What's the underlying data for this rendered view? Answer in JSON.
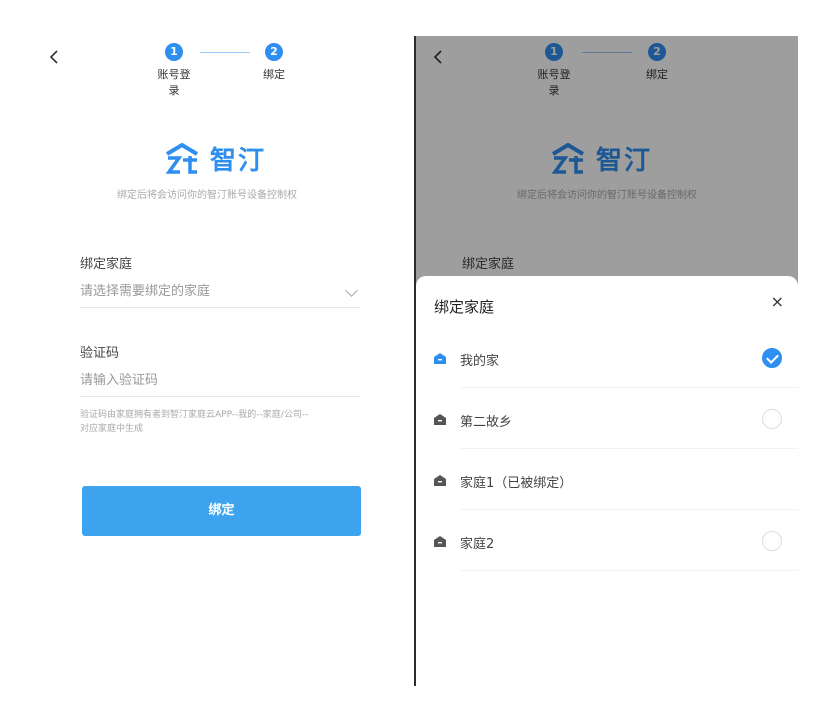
{
  "left": {
    "back_icon": "chevron-left-icon",
    "steps": [
      {
        "num": "1",
        "label": "账号登录"
      },
      {
        "num": "2",
        "label": "绑定"
      }
    ],
    "brand": {
      "name": "智汀",
      "subtitle": "绑定后将会访问你的智汀账号设备控制权"
    },
    "home_label": "绑定家庭",
    "home_placeholder": "请选择需要绑定的家庭",
    "code_label": "验证码",
    "code_placeholder": "请输入验证码",
    "hint_line1": "验证码由家庭拥有者到智汀家庭云APP--我的--家庭/公司--",
    "hint_line2": "对应家庭中生成",
    "bind_button": "绑定"
  },
  "right": {
    "steps": [
      {
        "num": "1",
        "label": "账号登录"
      },
      {
        "num": "2",
        "label": "绑定"
      }
    ],
    "brand": {
      "name": "智汀",
      "subtitle": "绑定后将会访问你的智汀账号设备控制权"
    },
    "home_label": "绑定家庭",
    "sheet": {
      "title": "绑定家庭",
      "close": "×",
      "items": [
        {
          "label": "我的家",
          "selected": true
        },
        {
          "label": "第二故乡",
          "selected": false
        },
        {
          "label": "家庭1（已被绑定）",
          "selected": false
        },
        {
          "label": "家庭2",
          "selected": false
        }
      ]
    }
  },
  "colors": {
    "accent": "#2f8ff0",
    "button": "#3ea3ee"
  }
}
